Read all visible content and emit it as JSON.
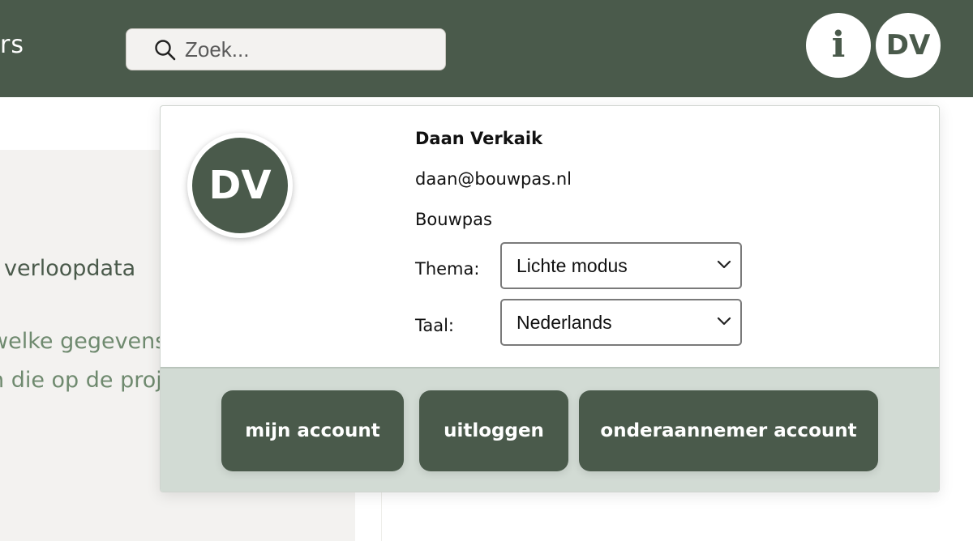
{
  "header": {
    "brand_fragment": "rs",
    "search": {
      "placeholder": "Zoek...",
      "value": ""
    },
    "info_button_label": "i",
    "avatar_initials": "DV"
  },
  "background": {
    "section_heading": "verloopdata",
    "section_desc_line1": "welke gegevens",
    "section_desc_line2": "n die op de proje"
  },
  "account_panel": {
    "avatar_initials": "DV",
    "name": "Daan Verkaik",
    "email": "daan@bouwpas.nl",
    "company": "Bouwpas",
    "theme": {
      "label": "Thema:",
      "selected": "Lichte modus"
    },
    "language": {
      "label": "Taal:",
      "selected": "Nederlands"
    },
    "buttons": {
      "my_account": "mijn account",
      "logout": "uitloggen",
      "subcontractor_account": "onderaannemer account"
    }
  },
  "colors": {
    "brand_green": "#4a5a4b",
    "footer_bg": "#d2dbd4",
    "muted_text": "#6f8a6f"
  },
  "icons": [
    "search-icon",
    "info-icon",
    "chevron-down-icon"
  ]
}
